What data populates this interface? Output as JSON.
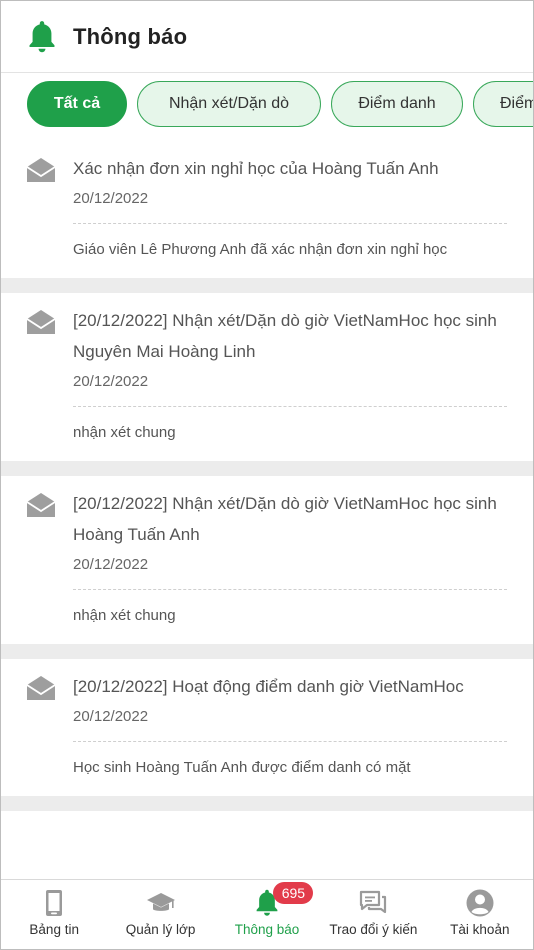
{
  "header": {
    "title": "Thông báo",
    "icon": "bell-icon",
    "accent": "#1fa04a"
  },
  "chips": [
    "Tất cả",
    "Nhận xét/Dặn dò",
    "Điểm danh",
    "Điểm"
  ],
  "notifications": [
    {
      "title": "Xác nhận đơn xin nghỉ học của Hoàng Tuấn Anh",
      "date": "20/12/2022",
      "body": "Giáo viên Lê Phương Anh  đã xác nhận đơn xin nghỉ học"
    },
    {
      "title": "[20/12/2022] Nhận xét/Dặn dò giờ VietNamHoc học sinh Nguyên Mai Hoàng Linh",
      "date": "20/12/2022",
      "body": "nhận xét chung"
    },
    {
      "title": "[20/12/2022] Nhận xét/Dặn dò giờ VietNamHoc học sinh Hoàng Tuấn Anh",
      "date": "20/12/2022",
      "body": "nhận xét chung"
    },
    {
      "title": "[20/12/2022] Hoạt động điểm danh giờ VietNamHoc",
      "date": "20/12/2022",
      "body": "Học sinh Hoàng Tuấn Anh  được điểm danh có mặt"
    }
  ],
  "bottom_nav": {
    "items": [
      "Bảng tin",
      "Quản lý lớp",
      "Thông báo",
      "Trao đổi ý kiến",
      "Tài khoản"
    ],
    "badge": "695",
    "active_color": "#1fa04a",
    "badge_color": "#e23b4a"
  }
}
